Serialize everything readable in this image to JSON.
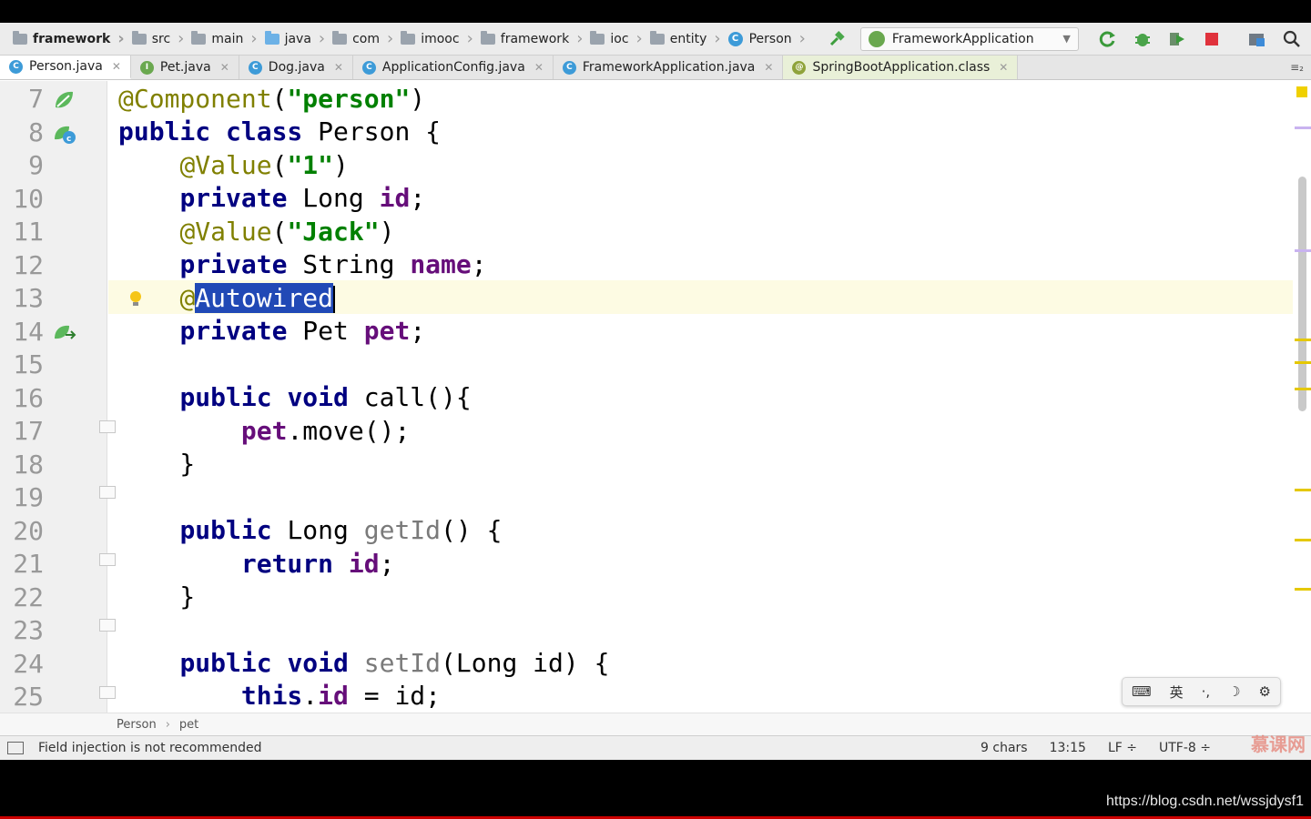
{
  "navbar": {
    "crumbs": [
      {
        "label": "framework",
        "icon": "module-folder-icon"
      },
      {
        "label": "src",
        "icon": "folder-icon"
      },
      {
        "label": "main",
        "icon": "folder-icon"
      },
      {
        "label": "java",
        "icon": "source-folder-icon"
      },
      {
        "label": "com",
        "icon": "package-icon"
      },
      {
        "label": "imooc",
        "icon": "package-icon"
      },
      {
        "label": "framework",
        "icon": "package-icon"
      },
      {
        "label": "ioc",
        "icon": "package-icon"
      },
      {
        "label": "entity",
        "icon": "package-icon"
      },
      {
        "label": "Person",
        "icon": "class-icon",
        "badge": "C"
      }
    ],
    "run_config": "FrameworkApplication"
  },
  "tabs": [
    {
      "label": "Person.java",
      "badge": "C",
      "color": "#3d9bd8"
    },
    {
      "label": "Pet.java",
      "badge": "I",
      "color": "#6aa84f"
    },
    {
      "label": "Dog.java",
      "badge": "C",
      "color": "#3d9bd8"
    },
    {
      "label": "ApplicationConfig.java",
      "badge": "C",
      "color": "#3d9bd8"
    },
    {
      "label": "FrameworkApplication.java",
      "badge": "C",
      "color": "#3d9bd8"
    },
    {
      "label": "SpringBootApplication.class",
      "badge": "@",
      "color": "#8fa33a"
    }
  ],
  "tabs_menu": "≡₂",
  "editor": {
    "line_numbers": [
      "7",
      "8",
      "9",
      "10",
      "11",
      "12",
      "13",
      "14",
      "15",
      "16",
      "17",
      "18",
      "19",
      "20",
      "21",
      "22",
      "23",
      "24",
      "25"
    ],
    "current_line": "13"
  },
  "breadcrumb": {
    "items": [
      "Person",
      "pet"
    ]
  },
  "status": {
    "message": "Field injection is not recommended",
    "chars": "9 chars",
    "position": "13:15",
    "line_sep": "LF ÷",
    "encoding": "UTF-8 ÷"
  },
  "ime": {
    "items": [
      "⌨",
      "英",
      "·,",
      "☽",
      "⚙"
    ]
  },
  "watermark": {
    "url": "https://blog.csdn.net/wssjdysf1",
    "logo": "慕课网"
  },
  "colors": {
    "keyword": "#000080",
    "annotation": "#808000",
    "string": "#008000",
    "field": "#660e7a",
    "selection": "#2149b6",
    "current_line": "#fdfbe3"
  }
}
